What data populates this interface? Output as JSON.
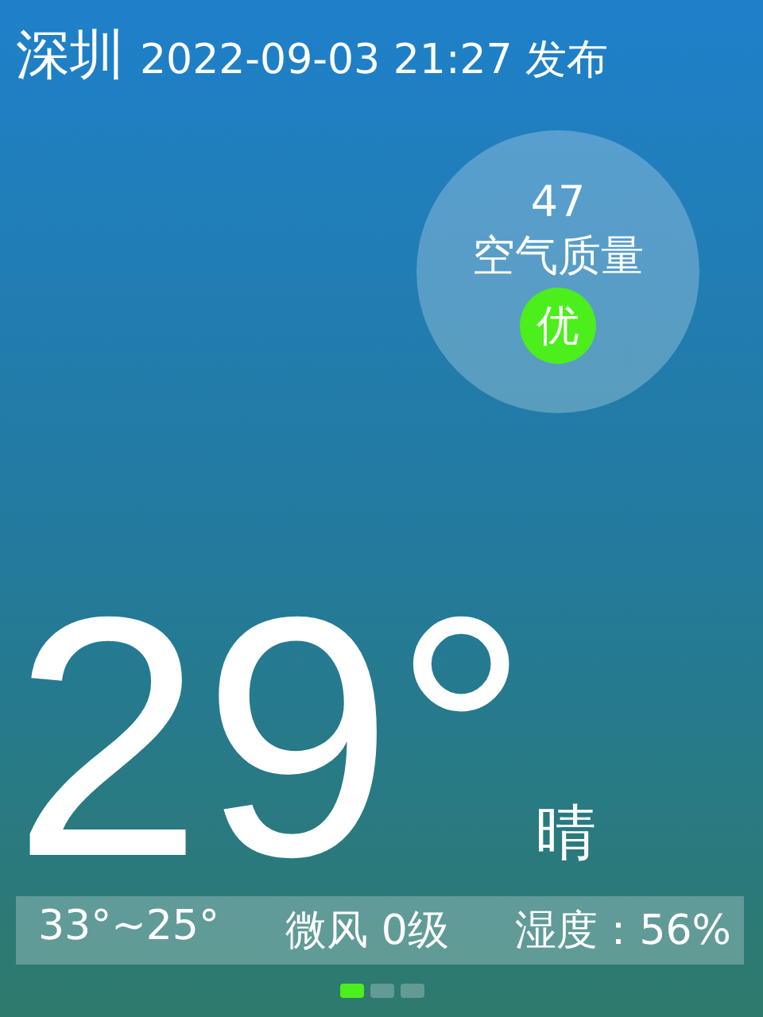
{
  "header": {
    "city": "深圳",
    "published": "2022-09-03 21:27 发布"
  },
  "air_quality": {
    "index": "47",
    "label": "空气质量",
    "grade": "优",
    "color": "#4cee1c"
  },
  "current": {
    "temperature": "29°",
    "condition": "晴"
  },
  "details": [
    "33°~25°",
    "微风 0级",
    "湿度：56%"
  ],
  "pages": [
    {
      "selected": true
    },
    {
      "selected": false
    },
    {
      "selected": false
    }
  ]
}
